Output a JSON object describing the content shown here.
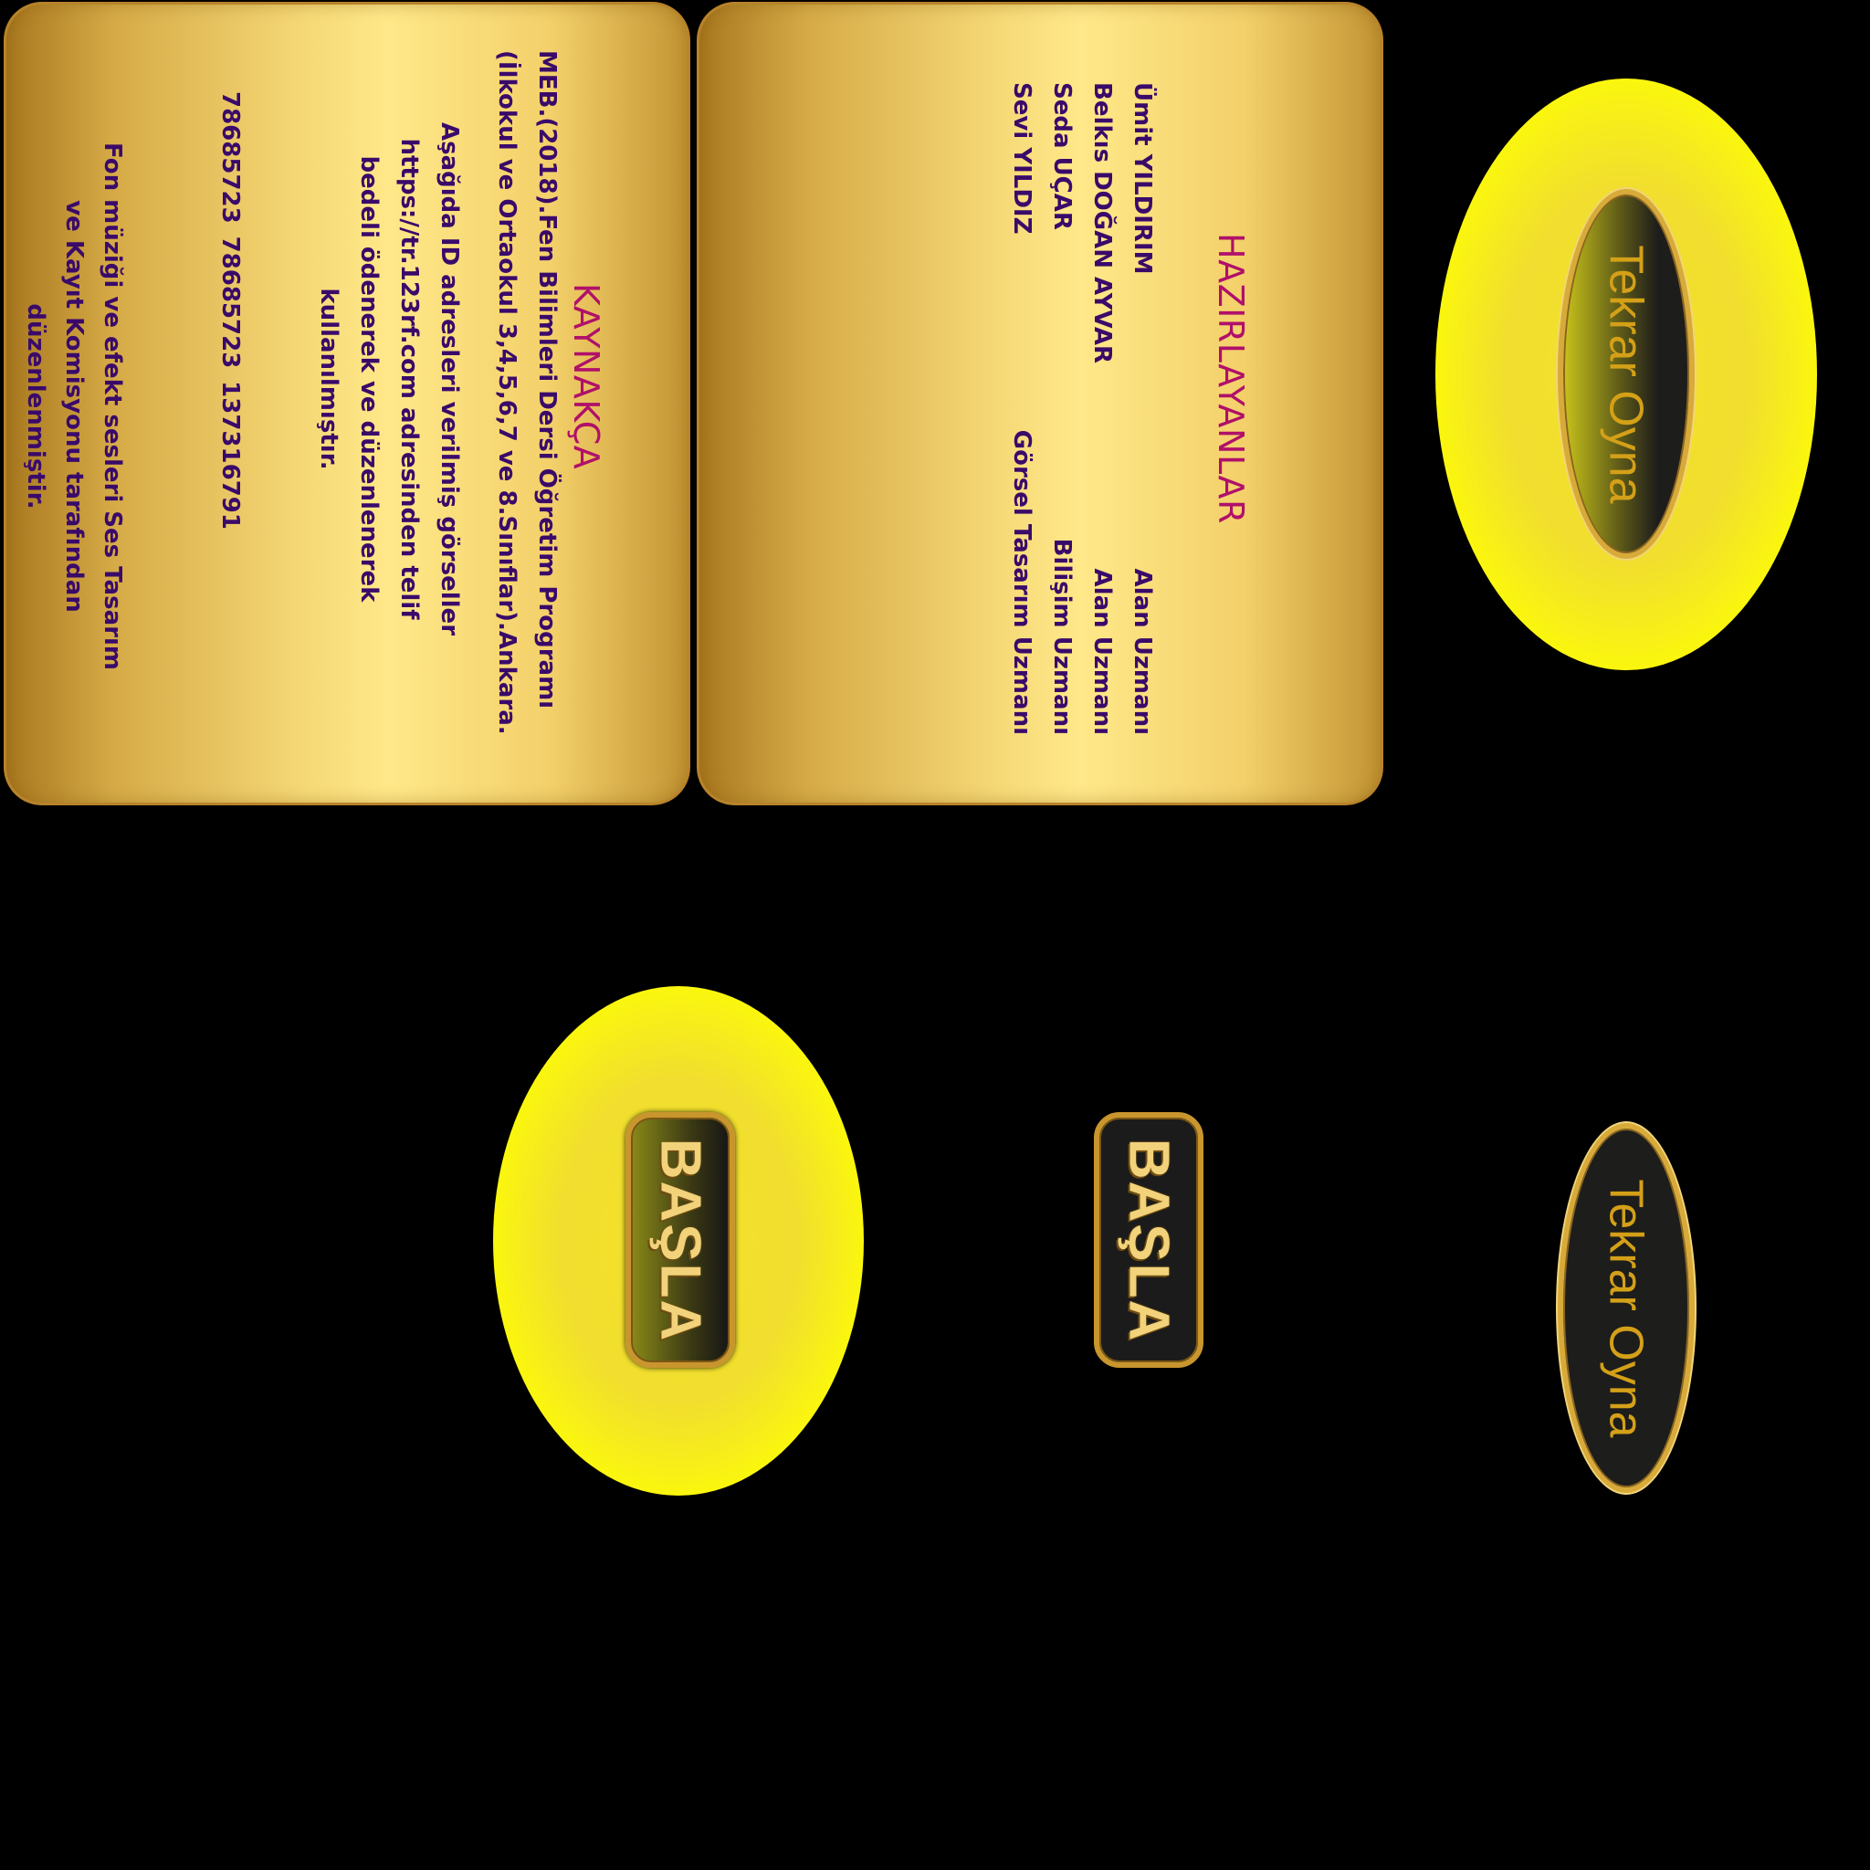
{
  "kaynakca": {
    "title": "KAYNAKÇA",
    "reference": "MEB.(2018).Fen Bilimleri Dersi Öğretim Programı (İlkokul ve Ortaokul 3,4,5,6,7 ve 8.Sınıflar).Ankara.",
    "image_note": "Aşağıda ID adresleri verilmiş görseller https://tr.123rf.com adresinden telif bedeli ödenerek ve düzenlenerek kullanılmıştır.",
    "image_ids": [
      "78685723",
      "78685723",
      "137316791"
    ],
    "sound_note": "Fon müziği ve efekt sesleri Ses Tasarım ve Kayıt Komisyonu tarafından düzenlenmiştir."
  },
  "hazirlayanlar": {
    "title": "HAZIRLAYANLAR",
    "people": [
      {
        "name": "Ümit YILDIRIM",
        "role": "Alan Uzmanı"
      },
      {
        "name": "Belkıs DOĞAN AYVAR",
        "role": "Alan Uzmanı"
      },
      {
        "name": "Seda UÇAR",
        "role": "Bilişim Uzmanı"
      },
      {
        "name": "Sevi YILDIZ",
        "role": "Görsel Tasarım Uzmanı"
      }
    ]
  },
  "buttons": {
    "replay_label": "Tekrar Oyna",
    "start_label": "BAŞLA"
  }
}
